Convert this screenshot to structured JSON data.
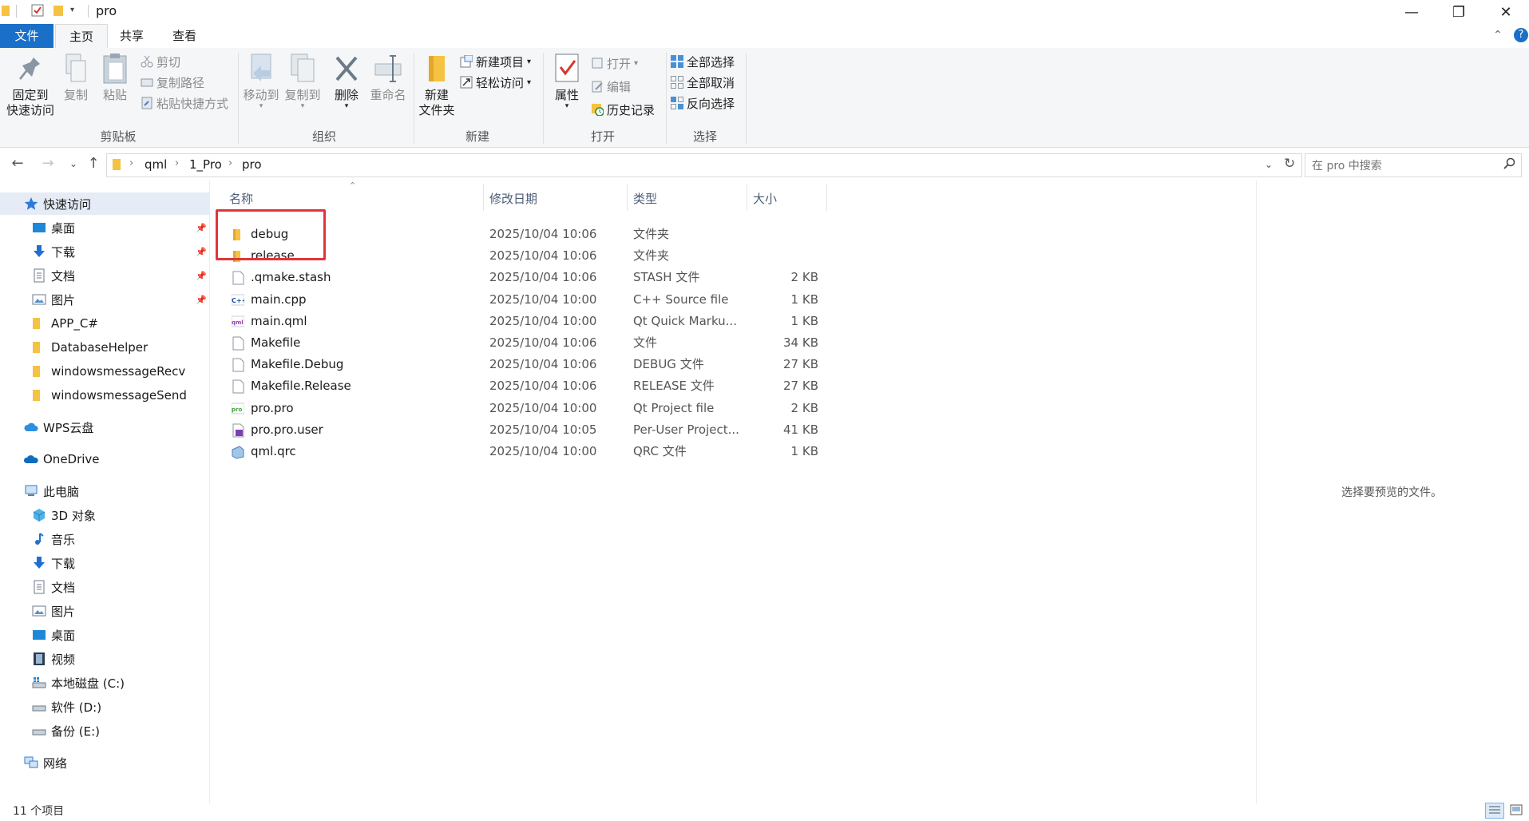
{
  "window": {
    "title": "pro",
    "minimize": "—",
    "maximize": "❐",
    "close": "✕"
  },
  "tabs": [
    {
      "label": "文件"
    },
    {
      "label": "主页"
    },
    {
      "label": "共享"
    },
    {
      "label": "查看"
    }
  ],
  "ribbon": {
    "clipboard": {
      "label": "剪贴板",
      "pin": "固定到\n快速访问",
      "pin_line1": "固定到",
      "pin_line2": "快速访问",
      "copy": "复制",
      "paste": "粘贴",
      "cut": "剪切",
      "copy_path": "复制路径",
      "paste_shortcut": "粘贴快捷方式"
    },
    "organize": {
      "label": "组织",
      "move_to": "移动到",
      "copy_to": "复制到",
      "delete": "删除",
      "rename": "重命名"
    },
    "new": {
      "label": "新建",
      "new_folder_line1": "新建",
      "new_folder_line2": "文件夹",
      "new_item": "新建项目",
      "easy_access": "轻松访问"
    },
    "open": {
      "label": "打开",
      "properties": "属性",
      "open": "打开",
      "edit": "编辑",
      "history": "历史记录"
    },
    "select": {
      "label": "选择",
      "select_all": "全部选择",
      "select_none": "全部取消",
      "invert": "反向选择"
    }
  },
  "address": {
    "crumbs": [
      "qml",
      "1_Pro",
      "pro"
    ],
    "search_placeholder": "在 pro 中搜索"
  },
  "sidebar": {
    "quick_access": "快速访问",
    "quick_items": [
      {
        "label": "桌面",
        "pinned": true
      },
      {
        "label": "下载",
        "pinned": true
      },
      {
        "label": "文档",
        "pinned": true
      },
      {
        "label": "图片",
        "pinned": true
      },
      {
        "label": "APP_C#"
      },
      {
        "label": "DatabaseHelper"
      },
      {
        "label": "windowsmessageRecv"
      },
      {
        "label": "windowsmessageSend"
      }
    ],
    "wps": "WPS云盘",
    "onedrive": "OneDrive",
    "this_pc": "此电脑",
    "pc_items": [
      {
        "label": "3D 对象"
      },
      {
        "label": "音乐"
      },
      {
        "label": "下载"
      },
      {
        "label": "文档"
      },
      {
        "label": "图片"
      },
      {
        "label": "桌面"
      },
      {
        "label": "视频"
      },
      {
        "label": "本地磁盘 (C:)"
      },
      {
        "label": "软件 (D:)"
      },
      {
        "label": "备份 (E:)"
      }
    ],
    "network": "网络"
  },
  "columns": {
    "name": "名称",
    "date": "修改日期",
    "type": "类型",
    "size": "大小"
  },
  "files": [
    {
      "name": "debug",
      "date": "2025/10/04 10:06",
      "type": "文件夹",
      "size": "",
      "icon": "folder-icon"
    },
    {
      "name": "release",
      "date": "2025/10/04 10:06",
      "type": "文件夹",
      "size": "",
      "icon": "folder-icon"
    },
    {
      "name": ".qmake.stash",
      "date": "2025/10/04 10:06",
      "type": "STASH 文件",
      "size": "2 KB",
      "icon": "file-icon"
    },
    {
      "name": "main.cpp",
      "date": "2025/10/04 10:00",
      "type": "C++ Source file",
      "size": "1 KB",
      "icon": "cpp-file-icon"
    },
    {
      "name": "main.qml",
      "date": "2025/10/04 10:00",
      "type": "Qt Quick Marku...",
      "size": "1 KB",
      "icon": "qml-file-icon"
    },
    {
      "name": "Makefile",
      "date": "2025/10/04 10:06",
      "type": "文件",
      "size": "34 KB",
      "icon": "file-icon"
    },
    {
      "name": "Makefile.Debug",
      "date": "2025/10/04 10:06",
      "type": "DEBUG 文件",
      "size": "27 KB",
      "icon": "file-icon"
    },
    {
      "name": "Makefile.Release",
      "date": "2025/10/04 10:06",
      "type": "RELEASE 文件",
      "size": "27 KB",
      "icon": "file-icon"
    },
    {
      "name": "pro.pro",
      "date": "2025/10/04 10:00",
      "type": "Qt Project file",
      "size": "2 KB",
      "icon": "qt-project-icon"
    },
    {
      "name": "pro.pro.user",
      "date": "2025/10/04 10:05",
      "type": "Per-User Project...",
      "size": "41 KB",
      "icon": "user-file-icon"
    },
    {
      "name": "qml.qrc",
      "date": "2025/10/04 10:00",
      "type": "QRC 文件",
      "size": "1 KB",
      "icon": "qrc-file-icon"
    }
  ],
  "preview": {
    "text": "选择要预览的文件。"
  },
  "status": {
    "count": "11 个项目"
  },
  "colors": {
    "accent": "#1a6fc9",
    "folder": "#f5c242",
    "highlight_box": "#e0353b"
  }
}
